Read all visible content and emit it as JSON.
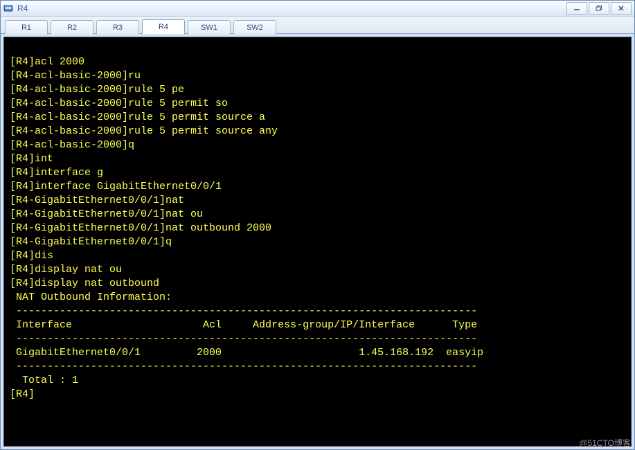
{
  "window": {
    "title": "R4"
  },
  "tabs": [
    {
      "label": "R1",
      "active": false
    },
    {
      "label": "R2",
      "active": false
    },
    {
      "label": "R3",
      "active": false
    },
    {
      "label": "R4",
      "active": true
    },
    {
      "label": "SW1",
      "active": false
    },
    {
      "label": "SW2",
      "active": false
    }
  ],
  "terminal": {
    "lines": [
      "",
      "[R4]acl 2000",
      "[R4-acl-basic-2000]ru",
      "[R4-acl-basic-2000]rule 5 pe",
      "[R4-acl-basic-2000]rule 5 permit so",
      "[R4-acl-basic-2000]rule 5 permit source a",
      "[R4-acl-basic-2000]rule 5 permit source any",
      "[R4-acl-basic-2000]q",
      "[R4]int",
      "[R4]interface g",
      "[R4]interface GigabitEthernet0/0/1",
      "[R4-GigabitEthernet0/0/1]nat",
      "[R4-GigabitEthernet0/0/1]nat ou",
      "[R4-GigabitEthernet0/0/1]nat outbound 2000",
      "[R4-GigabitEthernet0/0/1]q",
      "[R4]dis",
      "[R4]display nat ou",
      "[R4]display nat outbound",
      " NAT Outbound Information:",
      " --------------------------------------------------------------------------",
      " Interface                     Acl     Address-group/IP/Interface      Type",
      " --------------------------------------------------------------------------",
      " GigabitEthernet0/0/1         2000                      1.45.168.192  easyip",
      " --------------------------------------------------------------------------",
      "  Total : 1",
      "[R4]"
    ],
    "nat_outbound_table": {
      "title": "NAT Outbound Information:",
      "columns": [
        "Interface",
        "Acl",
        "Address-group/IP/Interface",
        "Type"
      ],
      "rows": [
        {
          "Interface": "GigabitEthernet0/0/1",
          "Acl": "2000",
          "Address-group/IP/Interface": "1.45.168.192",
          "Type": "easyip"
        }
      ],
      "total_label": "Total : 1"
    }
  },
  "watermark": "@51CTO博客"
}
